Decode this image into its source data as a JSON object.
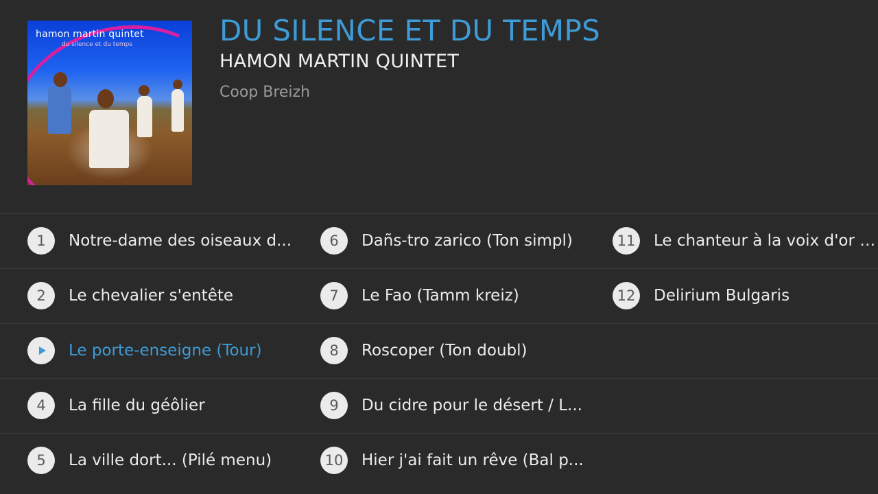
{
  "album": {
    "cover_title": "hamon martin quintet",
    "cover_subtitle": "du silence et du temps",
    "title": "DU SILENCE ET DU TEMPS",
    "artist": "HAMON MARTIN QUINTET",
    "label": "Coop Breizh"
  },
  "colors": {
    "accent": "#3d9bd6",
    "background": "#2a2a2a",
    "number_badge": "#ebebeb"
  },
  "now_playing_icon": "play-icon",
  "tracks": [
    {
      "number": "1",
      "title": "Notre-dame des oiseaux d..."
    },
    {
      "number": "2",
      "title": "Le chevalier s'entête"
    },
    {
      "number": "3",
      "title": "Le porte-enseigne (Tour)",
      "playing": true
    },
    {
      "number": "4",
      "title": "La fille du géôlier"
    },
    {
      "number": "5",
      "title": "La ville dort... (Pilé menu)"
    },
    {
      "number": "6",
      "title": "Dañs-tro zarico (Ton simpl)"
    },
    {
      "number": "7",
      "title": "Le Fao (Tamm kreiz)"
    },
    {
      "number": "8",
      "title": "Roscoper (Ton doubl)"
    },
    {
      "number": "9",
      "title": "Du cidre pour le désert / L..."
    },
    {
      "number": "10",
      "title": "Hier j'ai fait un rêve (Bal p..."
    },
    {
      "number": "11",
      "title": "Le chanteur à la voix d'or (..."
    },
    {
      "number": "12",
      "title": "Delirium Bulgaris"
    }
  ]
}
